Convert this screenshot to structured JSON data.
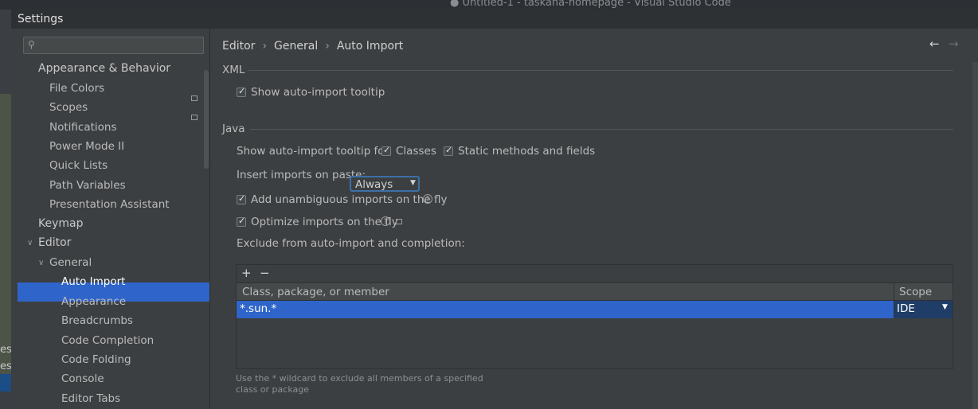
{
  "background_window": {
    "title": "● Untitled-1 - taskana-homepage - Visual Studio Code",
    "left_fragments": [
      "est",
      "est"
    ]
  },
  "dialog": {
    "title": "Settings"
  },
  "search": {
    "placeholder": ""
  },
  "sidebar": {
    "items": [
      {
        "label": "Appearance & Behavior",
        "level": 0
      },
      {
        "label": "File Colors",
        "level": 1
      },
      {
        "label": "Scopes",
        "level": 1
      },
      {
        "label": "Notifications",
        "level": 1
      },
      {
        "label": "Power Mode II",
        "level": 1
      },
      {
        "label": "Quick Lists",
        "level": 1
      },
      {
        "label": "Path Variables",
        "level": 1
      },
      {
        "label": "Presentation Assistant",
        "level": 1
      },
      {
        "label": "Keymap",
        "level": 0
      },
      {
        "label": "Editor",
        "level": 0
      },
      {
        "label": "General",
        "level": 1
      },
      {
        "label": "Auto Import",
        "level": 2,
        "selected": true
      },
      {
        "label": "Appearance",
        "level": 2
      },
      {
        "label": "Breadcrumbs",
        "level": 2
      },
      {
        "label": "Code Completion",
        "level": 2
      },
      {
        "label": "Code Folding",
        "level": 2
      },
      {
        "label": "Console",
        "level": 2
      },
      {
        "label": "Editor Tabs",
        "level": 2
      }
    ]
  },
  "breadcrumb": [
    "Editor",
    "General",
    "Auto Import"
  ],
  "nav": {
    "back": "←",
    "forward": "→"
  },
  "xml": {
    "title": "XML",
    "show_tooltip": {
      "label": "Show auto-import tooltip",
      "checked": true
    }
  },
  "java": {
    "title": "Java",
    "tooltip_for_label": "Show auto-import tooltip for:",
    "classes": {
      "label": "Classes",
      "checked": true
    },
    "static_methods": {
      "label": "Static methods and fields",
      "checked": true
    },
    "insert_on_paste_label": "Insert imports on paste:",
    "insert_on_paste_value": "Always",
    "add_unambiguous": {
      "label": "Add unambiguous imports on the fly",
      "checked": true
    },
    "optimize": {
      "label": "Optimize imports on the fly",
      "checked": true
    },
    "exclude_label": "Exclude from auto-import and completion:"
  },
  "table": {
    "add": "+",
    "remove": "−",
    "columns": [
      "Class, package, or member",
      "Scope"
    ],
    "rows": [
      {
        "member": "*.sun.*",
        "scope": "IDE"
      }
    ]
  },
  "hint": "Use the * wildcard to exclude all members of a specified class or package",
  "colors": {
    "selection": "#2f65ca",
    "background": "#3c3f41",
    "focus_border": "#3d6fa8"
  }
}
